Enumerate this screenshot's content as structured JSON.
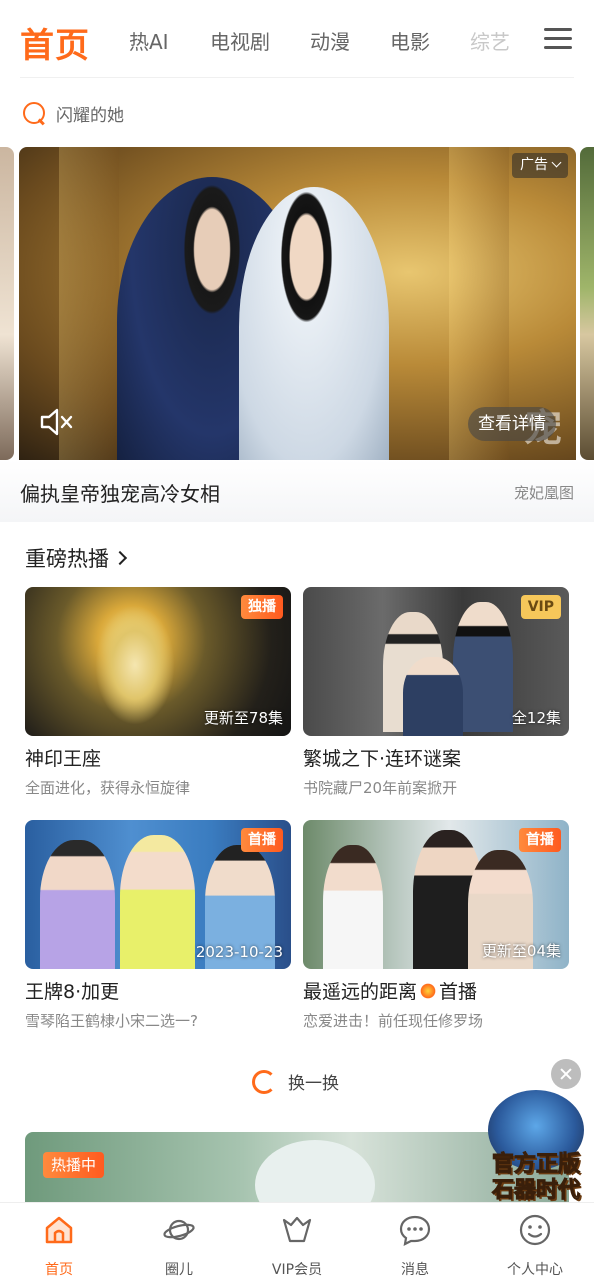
{
  "colors": {
    "accent": "#ff6a1a",
    "text": "#222222",
    "muted": "#888888"
  },
  "topnav": {
    "home": "首页",
    "tabs": [
      "热AI",
      "电视剧",
      "动漫",
      "电影",
      "综艺"
    ]
  },
  "search": {
    "placeholder": "闪耀的她"
  },
  "banner": {
    "ad_label": "广告",
    "detail_button": "查看详情",
    "watermark": "宠",
    "title": "偏执皇帝独宠高冷女相",
    "subtitle": "宠妃凰图"
  },
  "section": {
    "title": "重磅热播"
  },
  "cards": [
    {
      "badge": "独播",
      "overlay": "更新至78集",
      "title": "神印王座",
      "subtitle": "全面进化，获得永恒旋律"
    },
    {
      "badge": "VIP",
      "overlay": "全12集",
      "title": "繁城之下·连环谜案",
      "subtitle": "书院藏尸20年前案掀开"
    },
    {
      "badge": "首播",
      "overlay": "2023-10-23",
      "title": "王牌8·加更",
      "subtitle": "雪琴陷王鹤棣小宋二选一?"
    },
    {
      "badge": "首播",
      "overlay": "更新至04集",
      "title_a": "最遥远的距离",
      "title_b": "首播",
      "subtitle": "恋爱进击！前任现任修罗场"
    }
  ],
  "refresh": {
    "label": "换一换"
  },
  "next_card": {
    "badge": "热播中"
  },
  "float_ad": {
    "line1": "官方正版",
    "line2": "石器时代"
  },
  "bottomnav": [
    {
      "label": "首页",
      "icon": "home-icon",
      "active": true
    },
    {
      "label": "圈儿",
      "icon": "planet-icon"
    },
    {
      "label": "VIP会员",
      "icon": "vip-crown-icon"
    },
    {
      "label": "消息",
      "icon": "message-icon"
    },
    {
      "label": "个人中心",
      "icon": "smile-profile-icon"
    }
  ]
}
